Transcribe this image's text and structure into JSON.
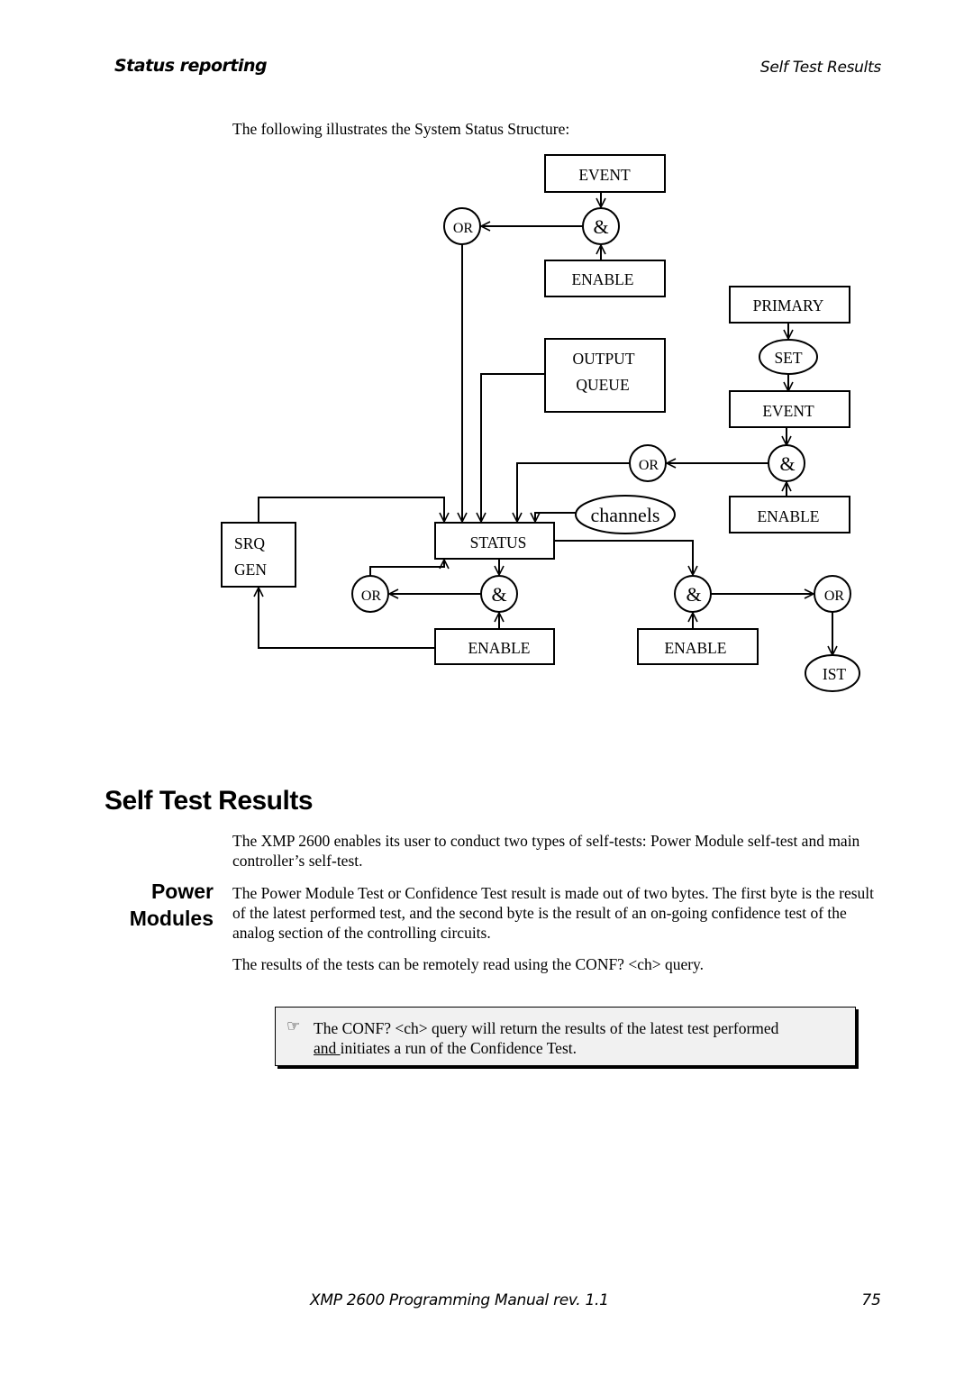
{
  "header": {
    "section": "Status reporting",
    "topic": "Self Test Results"
  },
  "intro": "The following illustrates the System Status Structure:",
  "diagram": {
    "boxes": {
      "event_top": "EVENT",
      "enable_top": "ENABLE",
      "output_queue_line1": "OUTPUT",
      "output_queue_line2": "QUEUE",
      "primary": "PRIMARY",
      "event_right": "EVENT",
      "enable_right": "ENABLE",
      "srq_line1": "SRQ",
      "srq_line2": "GEN",
      "status": "STATUS",
      "enable_bottom_left": "ENABLE",
      "enable_bottom_right": "ENABLE"
    },
    "nodes": {
      "or": "OR",
      "and": "&",
      "set": "SET",
      "channels": "channels",
      "ist": "IST"
    }
  },
  "section_title": "Self Test Results",
  "subsection_title_line1": "Power",
  "subsection_title_line2": "Modules",
  "paragraphs": [
    "The XMP 2600 enables its user to conduct two types of self-tests: Power Module self-test and main controller’s self-test.",
    "The Power Module Test or Confidence Test result is made out of two bytes. The first byte is the result of the latest performed test, and the second byte is the result of an on-going confidence test of the analog section of the controlling circuits.",
    "The results of the tests can be remotely read using the CONF? <ch> query."
  ],
  "note": {
    "icon": "pointing-hand-icon",
    "text_line1": "The CONF? <ch> query will return the results of the latest test performed",
    "underlined": "and ",
    "text_line2_rest": "initiates a run of the Confidence Test."
  },
  "footer": {
    "manual": "XMP 2600 Programming Manual rev. 1.1",
    "page": "75"
  }
}
